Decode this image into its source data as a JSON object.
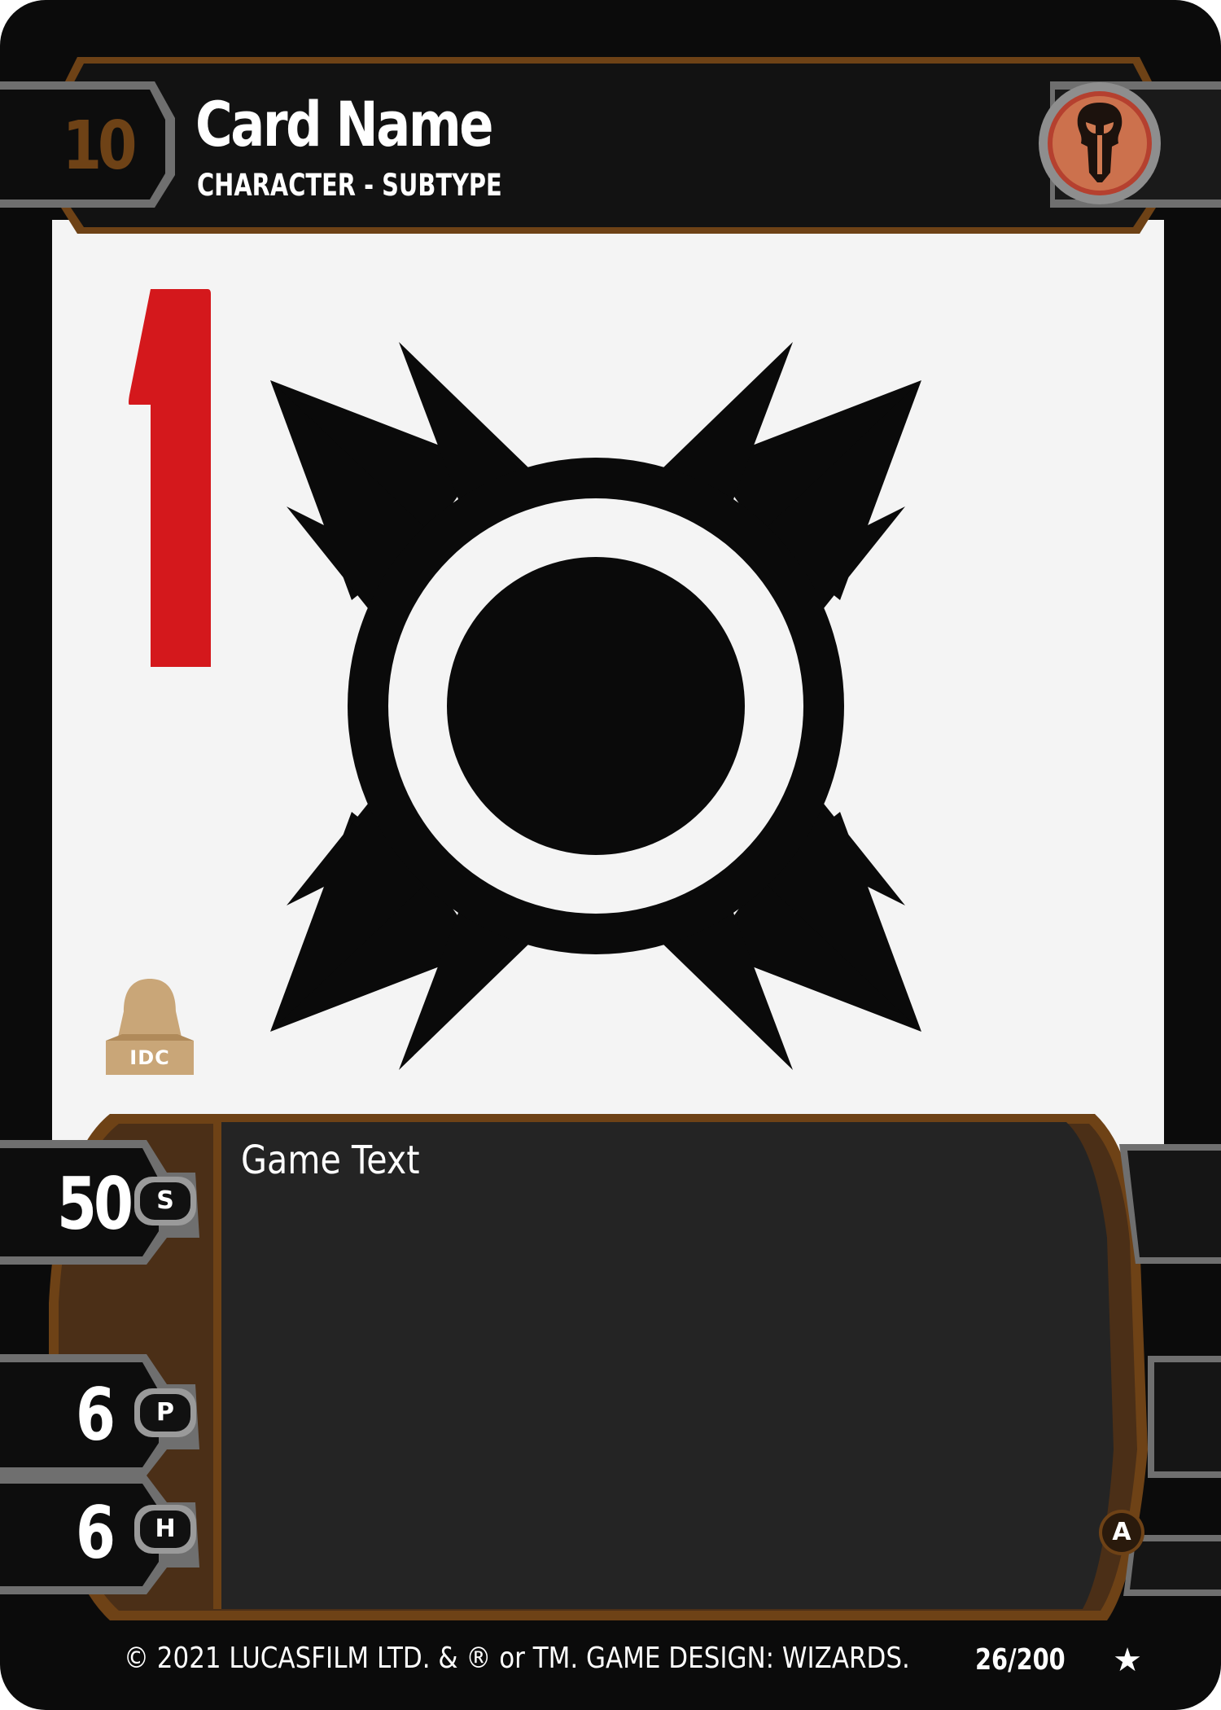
{
  "card": {
    "cost": "10",
    "name": "Card Name",
    "type_line": "CHARACTER - SUBTYPE",
    "game_text": "Game Text",
    "stats": [
      {
        "value": "50",
        "letter": "S"
      },
      {
        "value": "6",
        "letter": "P"
      },
      {
        "value": "6",
        "letter": "H"
      }
    ],
    "rarity": "A",
    "collector_number": "26/200",
    "copyright": "© 2021 LUCASFILM LTD. & ® or TM. GAME DESIGN: WIZARDS.",
    "star_glyph": "★",
    "affiliation_badge": "IDC",
    "red_number": "1"
  },
  "icons": {
    "faction": "mandalorian-skull-icon",
    "art": "sith-emblem-icon",
    "badge": "darth-vader-helmet-icon",
    "rarity": "circle-badge-icon",
    "set": "star-icon"
  },
  "colors": {
    "card_black": "#0b0b0b",
    "frame_brown": "#6e4216",
    "text_box": "#242424",
    "art_bg": "#f4f4f4",
    "red_numeral": "#d4181c",
    "badge_tan": "#c9a678"
  }
}
